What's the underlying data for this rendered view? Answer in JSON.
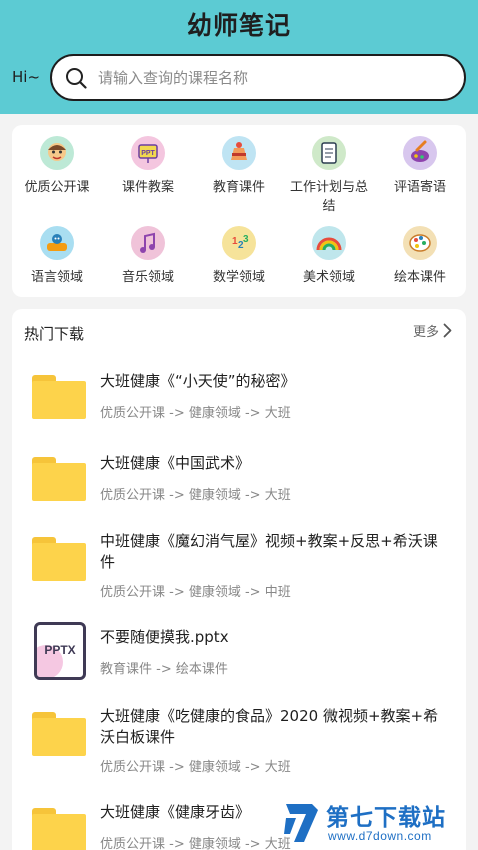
{
  "header": {
    "title": "幼师笔记",
    "greeting": "Hi~",
    "search": {
      "placeholder": "请输入查询的课程名称",
      "value": ""
    }
  },
  "categories": [
    {
      "label": "优质公开课",
      "icon": "teacher-icon",
      "color": "#bde9d6"
    },
    {
      "label": "课件教案",
      "icon": "ppt-board-icon",
      "color": "#f4c6df"
    },
    {
      "label": "教育课件",
      "icon": "cake-icon",
      "color": "#bfe4f3"
    },
    {
      "label": "工作计划与总结",
      "icon": "clipboard-icon",
      "color": "#cfe9c9"
    },
    {
      "label": "评语寄语",
      "icon": "paint-brush-icon",
      "color": "#d8c7ee"
    },
    {
      "label": "语言领域",
      "icon": "letters-icon",
      "color": "#a9def1"
    },
    {
      "label": "音乐领域",
      "icon": "music-icon",
      "color": "#f0c3d9"
    },
    {
      "label": "数学领域",
      "icon": "numbers-icon",
      "color": "#f6e39a"
    },
    {
      "label": "美术领域",
      "icon": "rainbow-icon",
      "color": "#bfe6ec"
    },
    {
      "label": "绘本课件",
      "icon": "palette-icon",
      "color": "#f3e0b5"
    }
  ],
  "downloads": {
    "title": "热门下载",
    "more": "更多",
    "items": [
      {
        "title": "大班健康《“小天使”的秘密》",
        "path": "优质公开课 -> 健康领域 -> 大班",
        "type": "folder"
      },
      {
        "title": "大班健康《中国武术》",
        "path": "优质公开课 -> 健康领域 -> 大班",
        "type": "folder"
      },
      {
        "title": "中班健康《魔幻消气屋》视频+教案+反思+希沃课件",
        "path": "优质公开课 -> 健康领域 -> 中班",
        "type": "folder"
      },
      {
        "title": "不要随便摸我.pptx",
        "path": "教育课件 -> 绘本课件",
        "type": "pptx",
        "badge": "PPTX"
      },
      {
        "title": "大班健康《吃健康的食品》2020 微视频+教案+希沃白板课件",
        "path": "优质公开课 -> 健康领域 -> 大班",
        "type": "folder"
      },
      {
        "title": "大班健康《健康牙齿》",
        "path": "优质公开课 -> 健康领域 -> 大班",
        "type": "folder"
      }
    ]
  },
  "watermark": {
    "main": "第七下载站",
    "sub": "www.d7down.com"
  },
  "colors": {
    "header": "#5ccbd3",
    "folder": "#fdd34b",
    "watermark": "#1e6fc4"
  }
}
